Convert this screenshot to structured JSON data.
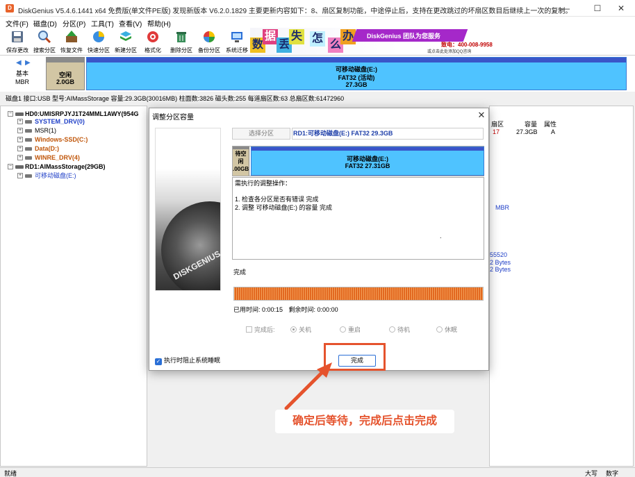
{
  "window": {
    "icon_letter": "D",
    "title": "DiskGenius V5.4.6.1441 x64 免费版(单文件PE版)   发现新版本 V6.2.0.1829   主要更新内容如下：8、扇区复制功能，中途停止后，支持在更改跳过的坏扇区数目后继续上一次的复制。",
    "minimize": "—",
    "maximize": "☐",
    "close": "✕"
  },
  "menu": [
    "文件(F)",
    "磁盘(D)",
    "分区(P)",
    "工具(T)",
    "查看(V)",
    "帮助(H)"
  ],
  "toolbar": [
    {
      "label": "保存更改",
      "icon": "save-icon"
    },
    {
      "label": "搜索分区",
      "icon": "search-icon"
    },
    {
      "label": "恢复文件",
      "icon": "recover-icon"
    },
    {
      "label": "快速分区",
      "icon": "quick-partition-icon"
    },
    {
      "label": "新建分区",
      "icon": "new-partition-icon"
    },
    {
      "label": "格式化",
      "icon": "format-icon"
    },
    {
      "label": "删除分区",
      "icon": "delete-icon"
    },
    {
      "label": "备份分区",
      "icon": "backup-icon"
    },
    {
      "label": "系统迁移",
      "icon": "migrate-icon"
    }
  ],
  "banner": {
    "tiles": [
      "数",
      "据",
      "丢",
      "失",
      "怎",
      "么",
      "办"
    ],
    "slogan": "DiskGenius 团队为您服务",
    "phone": "致电：400-008-9958",
    "hint": "或点击此处添加QQ咨询"
  },
  "diskmap": {
    "type_line1": "基本",
    "type_line2": "MBR",
    "free": {
      "label": "空闲",
      "size": "2.0GB"
    },
    "partition": {
      "name": "可移动磁盘(E:)",
      "fs": "FAT32 (活动)",
      "size": "27.3GB"
    }
  },
  "diskinfo": "磁盘1 接口:USB  型号:AIMassStorage  容量:29.3GB(30016MB)  柱面数:3826  磁头数:255  每道扇区数:63  总扇区数:61472960",
  "tree": [
    {
      "text": "HD0:UMISRPJYJ1T24MML1AWY(954G",
      "color": "#000000",
      "bold": true,
      "level": 0
    },
    {
      "text": "SYSTEM_DRV(0)",
      "color": "#1f3fc7",
      "bold": true,
      "level": 1
    },
    {
      "text": "MSR(1)",
      "color": "#000000",
      "bold": false,
      "level": 1
    },
    {
      "text": "Windows-SSD(C:)",
      "color": "#c0560a",
      "bold": true,
      "level": 1
    },
    {
      "text": "Data(D:)",
      "color": "#c0560a",
      "bold": true,
      "level": 1
    },
    {
      "text": "WINRE_DRV(4)",
      "color": "#c0560a",
      "bold": true,
      "level": 1
    },
    {
      "text": "RD1:AIMassStorage(29GB)",
      "color": "#000000",
      "bold": true,
      "level": 0
    },
    {
      "text": "可移动磁盘(E:)",
      "color": "#1f3fc7",
      "bold": false,
      "level": 1
    }
  ],
  "rightpane": {
    "headers": [
      "扇区",
      "容量",
      "属性"
    ],
    "row": [
      "17",
      "27.3GB",
      "A"
    ],
    "mbr": "MBR",
    "v1": "55520",
    "v2": "2 Bytes",
    "v3": "2 Bytes"
  },
  "dialog": {
    "title": "调整分区容量",
    "close": "✕",
    "select_btn": "选择分区",
    "target": "RD1:可移动磁盘(E:) FAT32 29.3GB",
    "brand": "DISKGENIUS",
    "map_free_top": "待空闲",
    "map_free_bottom": ".00GB",
    "map_part_name": "可移动磁盘(E:)",
    "map_part_fs": "FAT32 27.31GB",
    "ops_header": "需执行的调整操作：",
    "ops": [
      "1. 检查各分区是否有错误    完成",
      "2. 调整 可移动磁盘(E:) 的容量    完成"
    ],
    "ops_dot": ".",
    "status": "完成",
    "progress": 1.0,
    "elapsed": "已用时间:  0:00:15",
    "remaining": "剩余时间:  0:00:00",
    "after_label": "完成后:",
    "after_options": [
      "关机",
      "重启",
      "待机",
      "休眠"
    ],
    "after_selected": "关机",
    "prevent_sleep": "执行时阻止系统睡眠",
    "done_btn": "完成"
  },
  "annotation": {
    "text": "确定后等待，完成后点击完成"
  },
  "statusbar": {
    "left": "就绪",
    "caps": "大写",
    "num": "数字"
  },
  "colors": {
    "accent": "#e5532d",
    "partition": "#4fc3ff",
    "free": "#d2c6a4",
    "progress": "#e2681f"
  }
}
